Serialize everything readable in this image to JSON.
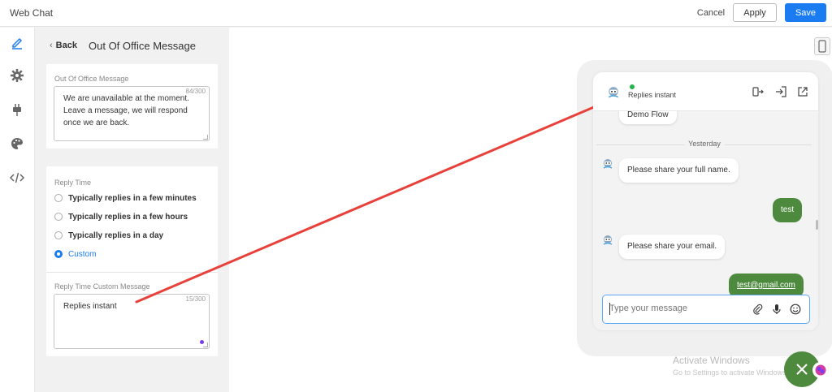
{
  "topbar": {
    "app_title": "Web Chat",
    "cancel_label": "Cancel",
    "apply_label": "Apply",
    "save_label": "Save"
  },
  "panel": {
    "back_label": "Back",
    "title": "Out Of Office Message",
    "ooo": {
      "label": "Out Of Office Message",
      "counter": "84/300",
      "value": "We are unavailable at the moment. Leave a message, we will respond once we are back."
    },
    "reply_time": {
      "label": "Reply Time",
      "options": [
        {
          "label": "Typically replies in a few minutes",
          "selected": false
        },
        {
          "label": "Typically replies in a few hours",
          "selected": false
        },
        {
          "label": "Typically replies in a day",
          "selected": false
        },
        {
          "label": "Custom",
          "selected": true
        }
      ]
    },
    "custom": {
      "label": "Reply Time Custom Message",
      "counter": "15/300",
      "value": "Replies instant"
    }
  },
  "preview": {
    "header_status": "Replies instant",
    "partial_bubble": "Demo Flow",
    "date_separator": "Yesterday",
    "messages": [
      {
        "from": "bot",
        "text": "Please share your full name."
      },
      {
        "from": "user",
        "text": "test"
      },
      {
        "from": "bot",
        "text": "Please share your email."
      },
      {
        "from": "user",
        "text": "test@gmail.com"
      }
    ],
    "composer_placeholder": "Type your message"
  },
  "watermark": {
    "line1": "Activate Windows",
    "line2": "Go to Settings to activate Windows."
  },
  "colors": {
    "accent": "#1a7cf0",
    "user_bubble": "#4e8a3e",
    "status_online": "#27b34a",
    "annotation_arrow": "#e8403a"
  }
}
